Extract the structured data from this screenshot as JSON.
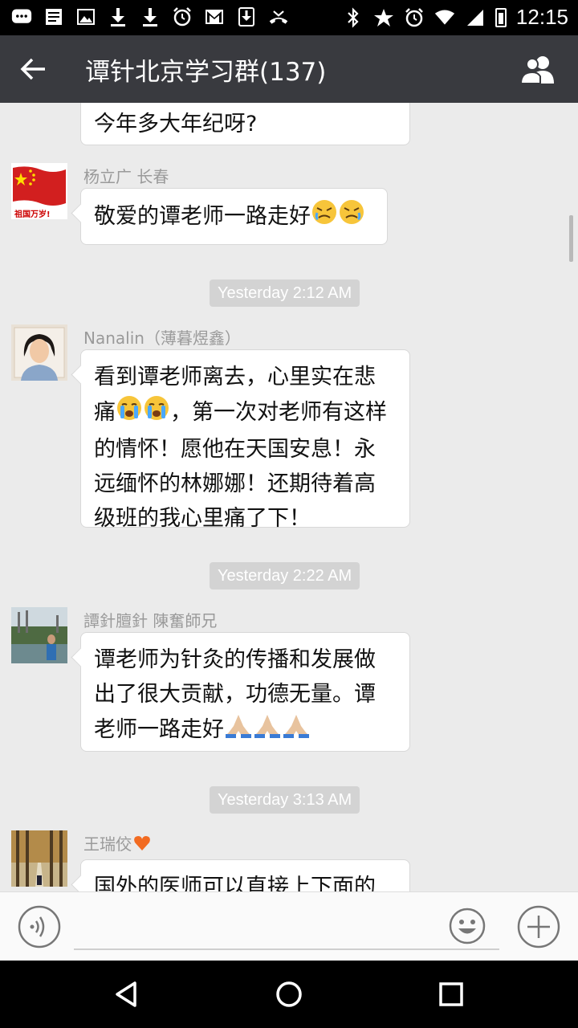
{
  "status_bar": {
    "left_icons": [
      "chat-bubble-icon",
      "newspaper-icon",
      "image-icon",
      "download-icon",
      "download-icon",
      "alarm-icon",
      "gmail-icon",
      "download-box-icon",
      "missed-call-icon"
    ],
    "right_icons": [
      "bluetooth-icon",
      "star-icon",
      "alarm-icon",
      "wifi-icon",
      "signal-icon",
      "battery-icon"
    ],
    "time": "12:15"
  },
  "toolbar": {
    "title": "谭针北京学习群(137)",
    "back_icon": "arrow-left-icon",
    "members_icon": "group-members-icon"
  },
  "chat": {
    "partial_message": {
      "text": "今年多大年纪呀?"
    },
    "messages": [
      {
        "sender": "杨立广  长春",
        "avatar": "china-flag-avatar",
        "avatar_caption": "祖国万岁!",
        "lines": [
          "敬爱的谭老师一路走好"
        ],
        "emojis": [
          "crying-face-emoji",
          "crying-face-emoji"
        ]
      },
      {
        "timestamp": "Yesterday 2:12 AM"
      },
      {
        "sender": "Nanalin（薄暮煜鑫）",
        "avatar": "woman-portrait-avatar",
        "lines": [
          "看到谭老师离去，心里实在悲",
          "痛",
          "，第一次对老师有这样",
          "的情怀！愿他在天国安息！永",
          "远缅怀的林娜娜！还期待着高",
          "级班的我心里痛了下！"
        ],
        "emojis": [
          "loudly-crying-emoji",
          "loudly-crying-emoji"
        ]
      },
      {
        "timestamp": "Yesterday 2:22 AM"
      },
      {
        "sender": "譚針膻針 陳奮師兄",
        "avatar": "landscape-person-avatar",
        "lines": [
          "谭老师为针灸的传播和发展做",
          "出了很大贡献，功德无量。谭",
          "老师一路走好"
        ],
        "emojis": [
          "praying-hands-emoji",
          "praying-hands-emoji",
          "praying-hands-emoji"
        ]
      },
      {
        "timestamp": "Yesterday 3:13 AM"
      },
      {
        "sender": "王瑞佼",
        "sender_emoji": "orange-heart-emoji",
        "avatar": "tree-path-avatar",
        "lines": [
          "国外的医师可以直接上下面的"
        ]
      }
    ]
  },
  "input_bar": {
    "voice_icon": "voice-input-icon",
    "emoji_icon": "smiley-icon",
    "plus_icon": "plus-circle-icon",
    "value": ""
  },
  "nav_bar": {
    "icons": [
      "back-triangle-icon",
      "home-circle-icon",
      "recents-square-icon"
    ]
  },
  "colors": {
    "toolbar_bg": "#393a3f",
    "chat_bg": "#ebebeb",
    "bubble_bg": "#ffffff",
    "timestamp_bg": "#d3d3d3"
  }
}
